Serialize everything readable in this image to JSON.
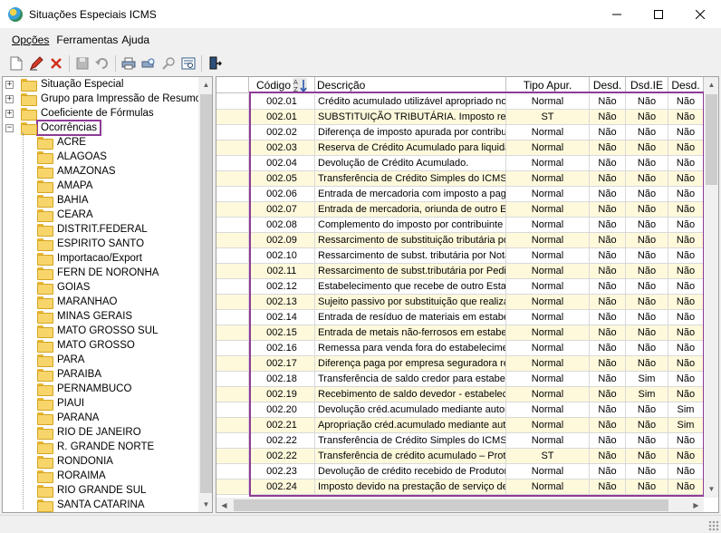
{
  "window": {
    "title": "Situações Especiais ICMS",
    "minimize": "—",
    "maximize": "☐",
    "close": "✕"
  },
  "menu": [
    {
      "label": "Opções",
      "accel": "O"
    },
    {
      "label": "Ferramentas",
      "accel": "F"
    },
    {
      "label": "Ajuda",
      "accel": "A"
    }
  ],
  "toolbar": [
    {
      "name": "new-icon"
    },
    {
      "name": "edit-icon"
    },
    {
      "name": "delete-icon"
    },
    {
      "name": "save-icon"
    },
    {
      "name": "undo-icon"
    },
    {
      "name": "print-icon"
    },
    {
      "name": "print-preview-icon"
    },
    {
      "name": "search-icon"
    },
    {
      "name": "view-icon"
    },
    {
      "name": "exit-icon"
    }
  ],
  "tree": {
    "roots": [
      {
        "label": "Situação Especial",
        "expander": "+"
      },
      {
        "label": "Grupo para Impressão de Resumo",
        "expander": "+"
      },
      {
        "label": "Coeficiente de Fórmulas",
        "expander": "+"
      },
      {
        "label": "Ocorrências",
        "expander": "−",
        "selected": true
      }
    ],
    "children": [
      "ACRE",
      "ALAGOAS",
      "AMAZONAS",
      "AMAPA",
      "BAHIA",
      "CEARA",
      "DISTRIT.FEDERAL",
      "ESPIRITO SANTO",
      "Importacao/Export",
      "FERN DE NORONHA",
      "GOIAS",
      "MARANHAO",
      "MINAS GERAIS",
      "MATO GROSSO SUL",
      "MATO GROSSO",
      "PARA",
      "PARAIBA",
      "PERNAMBUCO",
      "PIAUI",
      "PARANA",
      "RIO DE JANEIRO",
      "R. GRANDE NORTE",
      "RONDONIA",
      "RORAIMA",
      "RIO GRANDE SUL",
      "SANTA CATARINA"
    ]
  },
  "grid": {
    "columns": [
      "Código",
      "Descrição",
      "Tipo Apur.",
      "Desd.",
      "Dsd.IE",
      "Desd."
    ],
    "rows": [
      [
        "002.01",
        "Crédito acumulado utilizável apropriado no",
        "Normal",
        "Não",
        "Não",
        "Não"
      ],
      [
        "002.01",
        "SUBSTITUIÇÃO TRIBUTÁRIA. Imposto retid",
        "ST",
        "Não",
        "Não",
        "Não"
      ],
      [
        "002.02",
        "Diferença de imposto apurada por contribui",
        "Normal",
        "Não",
        "Não",
        "Não"
      ],
      [
        "002.03",
        "Reserva de Crédito Acumulado para liquida",
        "Normal",
        "Não",
        "Não",
        "Não"
      ],
      [
        "002.04",
        "Devolução de Crédito Acumulado.",
        "Normal",
        "Não",
        "Não",
        "Não"
      ],
      [
        "002.05",
        "Transferência de Crédito Simples do ICMS.",
        "Normal",
        "Não",
        "Não",
        "Não"
      ],
      [
        "002.06",
        "Entrada de mercadoria com imposto a paga",
        "Normal",
        "Não",
        "Não",
        "Não"
      ],
      [
        "002.07",
        "Entrada de mercadoria, oriunda de outro Es",
        "Normal",
        "Não",
        "Não",
        "Não"
      ],
      [
        "002.08",
        "Complemento do imposto por contribuinte s",
        "Normal",
        "Não",
        "Não",
        "Não"
      ],
      [
        "002.09",
        "Ressarcimento de substituição tributária po",
        "Normal",
        "Não",
        "Não",
        "Não"
      ],
      [
        "002.10",
        "Ressarcimento de subst. tributária por Nota",
        "Normal",
        "Não",
        "Não",
        "Não"
      ],
      [
        "002.11",
        "Ressarcimento de subst.tributária por Pedic",
        "Normal",
        "Não",
        "Não",
        "Não"
      ],
      [
        "002.12",
        "Estabelecimento que recebe de outro Estac",
        "Normal",
        "Não",
        "Não",
        "Não"
      ],
      [
        "002.13",
        "Sujeito passivo por substituição que realiza",
        "Normal",
        "Não",
        "Não",
        "Não"
      ],
      [
        "002.14",
        "Entrada de resíduo de materiais em estabel",
        "Normal",
        "Não",
        "Não",
        "Não"
      ],
      [
        "002.15",
        "Entrada de metais não-ferrosos em estabel",
        "Normal",
        "Não",
        "Não",
        "Não"
      ],
      [
        "002.16",
        "Remessa para venda fora do estabelecimer",
        "Normal",
        "Não",
        "Não",
        "Não"
      ],
      [
        "002.17",
        "Diferença paga por empresa seguradora re",
        "Normal",
        "Não",
        "Não",
        "Não"
      ],
      [
        "002.18",
        "Transferência de saldo credor para estabel",
        "Normal",
        "Não",
        "Sim",
        "Não"
      ],
      [
        "002.19",
        "Recebimento de saldo devedor - estabeleci",
        "Normal",
        "Não",
        "Sim",
        "Não"
      ],
      [
        "002.20",
        "Devolução créd.acumulado mediante autor",
        "Normal",
        "Não",
        "Não",
        "Sim"
      ],
      [
        "002.21",
        "Apropriação créd.acumulado mediante auto",
        "Normal",
        "Não",
        "Não",
        "Sim"
      ],
      [
        "002.22",
        "Transferência de Crédito Simples do ICMS,c",
        "Normal",
        "Não",
        "Não",
        "Não"
      ],
      [
        "002.22",
        "Transferência de crédito acumulado – Protc",
        "ST",
        "Não",
        "Não",
        "Não"
      ],
      [
        "002.23",
        "Devolução de crédito recebido de Produtor",
        "Normal",
        "Não",
        "Não",
        "Não"
      ],
      [
        "002.24",
        "Imposto devido na prestação de serviço de",
        "Normal",
        "Não",
        "Não",
        "Não"
      ]
    ]
  },
  "colors": {
    "highlight": "#8e3b96",
    "row_alt": "#fff9dc",
    "folder": "#f7d56b"
  }
}
